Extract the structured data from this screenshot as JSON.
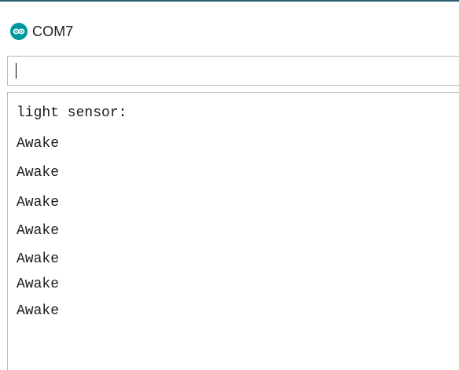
{
  "window": {
    "title": "COM7",
    "icon": "arduino-logo-icon",
    "accent_color": "#2d5f73",
    "icon_color": "#00979c"
  },
  "input": {
    "value": "",
    "placeholder": ""
  },
  "output": {
    "lines": [
      "light sensor:",
      "Awake",
      "Awake",
      "Awake",
      "Awake",
      "Awake",
      "Awake",
      "Awake"
    ]
  }
}
